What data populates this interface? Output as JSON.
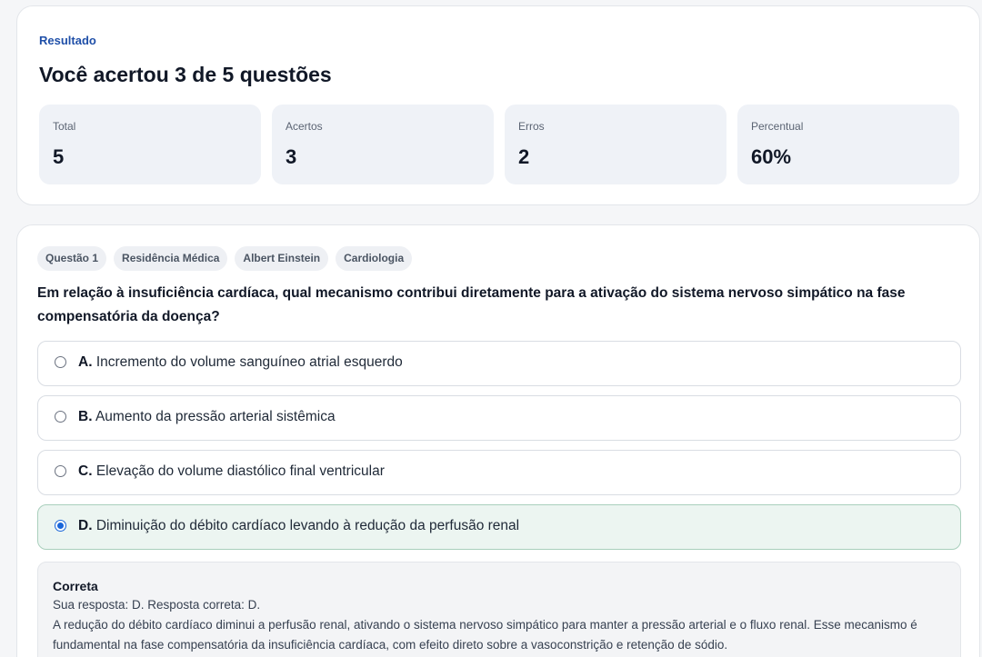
{
  "result": {
    "label": "Resultado",
    "title": "Você acertou 3 de 5 questões",
    "stats": [
      {
        "label": "Total",
        "value": "5"
      },
      {
        "label": "Acertos",
        "value": "3"
      },
      {
        "label": "Erros",
        "value": "2"
      },
      {
        "label": "Percentual",
        "value": "60%"
      }
    ]
  },
  "question": {
    "tags": [
      "Questão 1",
      "Residência Médica",
      "Albert Einstein",
      "Cardiologia"
    ],
    "text": "Em relação à insuficiência cardíaca, qual mecanismo contribui diretamente para a ativação do sistema nervoso simpático na fase compensatória da doença?",
    "options": [
      {
        "letter": "A.",
        "text": "Incremento do volume sanguíneo atrial esquerdo",
        "selected": false
      },
      {
        "letter": "B.",
        "text": "Aumento da pressão arterial sistêmica",
        "selected": false
      },
      {
        "letter": "C.",
        "text": "Elevação do volume diastólico final ventricular",
        "selected": false
      },
      {
        "letter": "D.",
        "text": "Diminuição do débito cardíaco levando à redução da perfusão renal",
        "selected": true
      }
    ],
    "feedback": {
      "status": "Correta",
      "answer": "Sua resposta: D. Resposta correta: D.",
      "explanation": "A redução do débito cardíaco diminui a perfusão renal, ativando o sistema nervoso simpático para manter a pressão arterial e o fluxo renal. Esse mecanismo é fundamental na fase compensatória da insuficiência cardíaca, com efeito direto sobre a vasoconstrição e retenção de sódio."
    }
  },
  "colors": {
    "accent": "#1f4fa8",
    "selected_bg": "#ecf5f1",
    "radio_selected": "#1a66d9"
  }
}
